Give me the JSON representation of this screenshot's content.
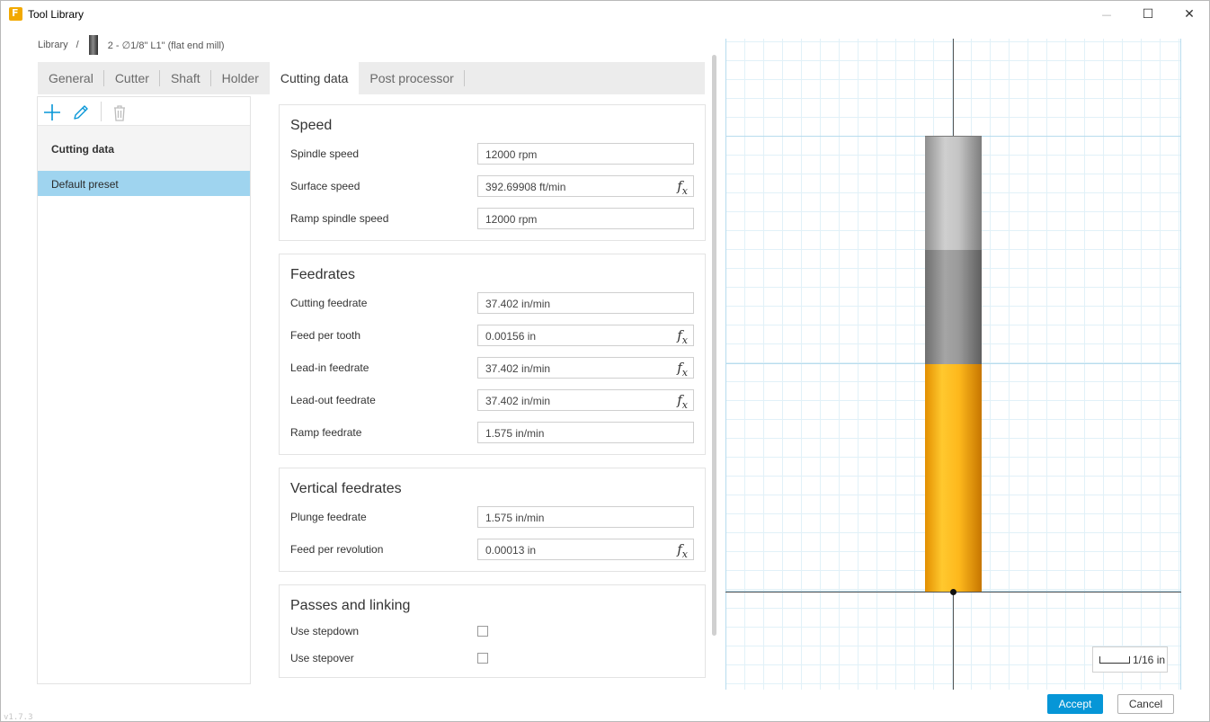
{
  "window": {
    "title": "Tool Library",
    "app_icon_letter": "F",
    "minimize_glyph": "—",
    "maximize_glyph": "☐",
    "close_glyph": "✕"
  },
  "breadcrumb": {
    "root": "Library",
    "separator": "/",
    "tool": "2 - ∅1/8\" L1\" (flat end mill)"
  },
  "tabs": [
    {
      "label": "General",
      "active": false
    },
    {
      "label": "Cutter",
      "active": false
    },
    {
      "label": "Shaft",
      "active": false
    },
    {
      "label": "Holder",
      "active": false
    },
    {
      "label": "Cutting data",
      "active": true
    },
    {
      "label": "Post processor",
      "active": false
    }
  ],
  "presets": {
    "toolbar": {
      "add_icon": "plus-icon",
      "edit_icon": "pencil-icon",
      "delete_icon": "trash-icon"
    },
    "group_label": "Cutting data",
    "items": [
      {
        "label": "Default preset",
        "selected": true
      }
    ]
  },
  "speed": {
    "title": "Speed",
    "rows": [
      {
        "label": "Spindle speed",
        "value": "12000 rpm",
        "has_fx": false
      },
      {
        "label": "Surface speed",
        "value": "392.69908 ft/min",
        "has_fx": true
      },
      {
        "label": "Ramp spindle speed",
        "value": "12000 rpm",
        "has_fx": false
      }
    ]
  },
  "feedrates": {
    "title": "Feedrates",
    "rows": [
      {
        "label": "Cutting feedrate",
        "value": "37.402 in/min",
        "has_fx": false
      },
      {
        "label": "Feed per tooth",
        "value": "0.00156 in",
        "has_fx": true
      },
      {
        "label": "Lead-in feedrate",
        "value": "37.402 in/min",
        "has_fx": true
      },
      {
        "label": "Lead-out feedrate",
        "value": "37.402 in/min",
        "has_fx": true
      },
      {
        "label": "Ramp feedrate",
        "value": "1.575 in/min",
        "has_fx": false
      }
    ]
  },
  "vertical_feedrates": {
    "title": "Vertical feedrates",
    "rows": [
      {
        "label": "Plunge feedrate",
        "value": "1.575 in/min",
        "has_fx": false
      },
      {
        "label": "Feed per revolution",
        "value": "0.00013 in",
        "has_fx": true
      }
    ]
  },
  "passes": {
    "title": "Passes and linking",
    "rows": [
      {
        "label": "Use stepdown",
        "checked": false
      },
      {
        "label": "Use stepover",
        "checked": false
      }
    ]
  },
  "fx_label": "f",
  "fx_sub": "x",
  "preview": {
    "scale_label": "1/16 in",
    "holder_color_top": "#c4c4c4",
    "holder_color_bottom": "#9a9a9a",
    "cutter_color": "#fdb81c"
  },
  "footer": {
    "accept": "Accept",
    "cancel": "Cancel",
    "version": "v1.7.3"
  },
  "colors": {
    "accent": "#0696d7",
    "selection": "#9fd4ef",
    "grid": "#b8dcee"
  }
}
